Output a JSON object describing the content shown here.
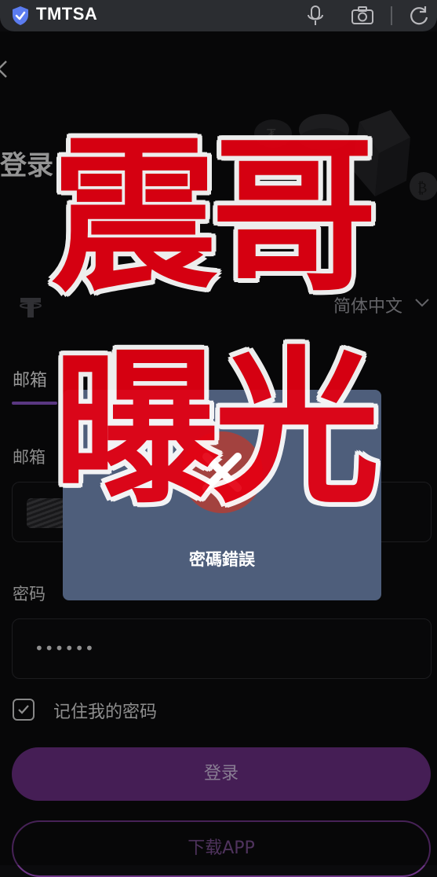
{
  "browser": {
    "site_name": "TMTSA",
    "icons": [
      "shield-icon",
      "microphone-icon",
      "camera-icon",
      "reload-icon"
    ]
  },
  "login": {
    "title": "登录",
    "language": "简体中文",
    "tab_email": "邮箱",
    "email_label": "邮箱",
    "password_label": "密码",
    "password_value": "••••••",
    "remember_label": "记住我的密码",
    "remember_checked": true,
    "login_button": "登录",
    "download_button": "下载APP"
  },
  "toast": {
    "message": "密碼錯誤",
    "icon": "error-x-icon"
  },
  "watermark": {
    "line1": "震哥",
    "line2": "曝光",
    "color": "#e50012"
  },
  "colors": {
    "accent": "#8b55c7",
    "button": "#6a2f83",
    "toast_bg": "#4e5e7b"
  }
}
